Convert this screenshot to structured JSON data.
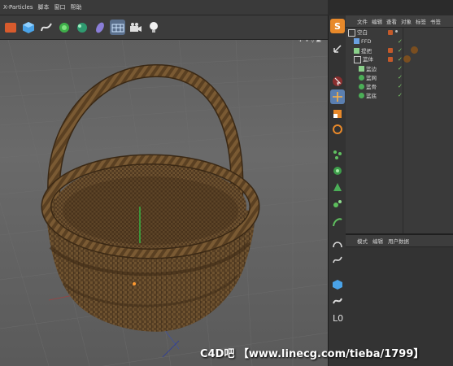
{
  "menubar": {
    "items": [
      "X-Particles",
      "脚本",
      "窗口",
      "帮助"
    ]
  },
  "toolbar": {
    "icons": [
      "undo-icon",
      "spline-icon",
      "nurbs-icon",
      "deformer-icon",
      "scene-icon",
      "camera-icon",
      "light-icon"
    ]
  },
  "viewport": {
    "header_icons": "✣ ↓ ◊ ▣"
  },
  "objmgr": {
    "menu": [
      "文件",
      "编辑",
      "查看",
      "对象",
      "标签",
      "书签"
    ],
    "rows": [
      {
        "indent": 0,
        "name": "空白",
        "icon": "null-icon"
      },
      {
        "indent": 1,
        "name": "FFD",
        "icon": "ffd-icon"
      },
      {
        "indent": 1,
        "name": "提把",
        "icon": "sweep-icon"
      },
      {
        "indent": 1,
        "name": "篮体",
        "icon": "null-icon"
      },
      {
        "indent": 2,
        "name": "篮边",
        "icon": "sweep-icon"
      },
      {
        "indent": 2,
        "name": "篮网",
        "icon": "cloner-icon"
      },
      {
        "indent": 2,
        "name": "篮骨",
        "icon": "cloner-icon"
      },
      {
        "indent": 2,
        "name": "篮底",
        "icon": "cloner-icon"
      }
    ]
  },
  "attr": {
    "tabs": [
      "模式",
      "编辑",
      "用户数据"
    ]
  },
  "watermark": "C4D吧 【www.linecg.com/tieba/1799】",
  "colors": {
    "accent_orange": "#e8892a",
    "basket_brown": "#6e5230",
    "check_green": "#7fd06a"
  }
}
